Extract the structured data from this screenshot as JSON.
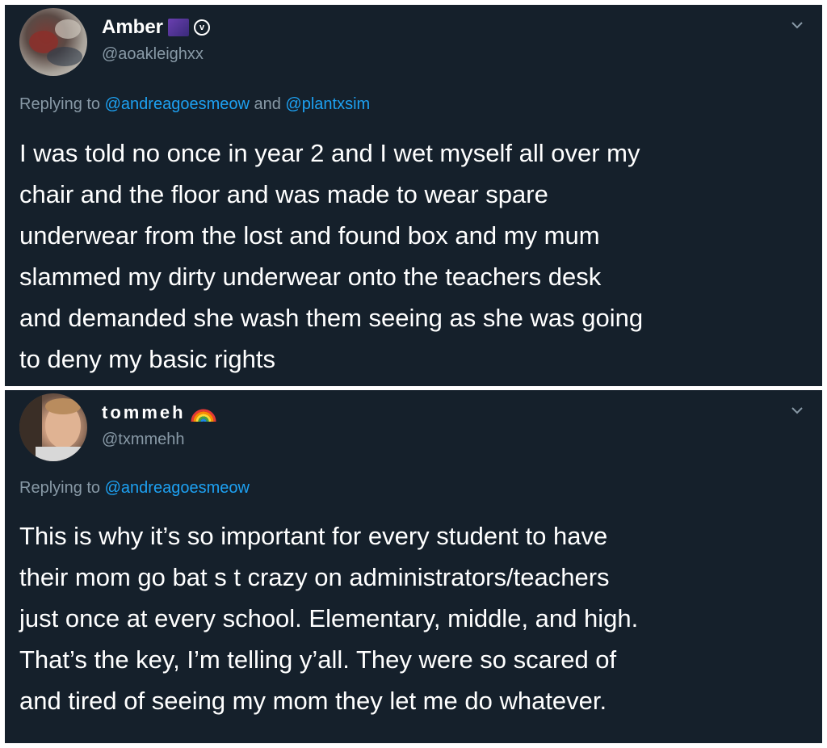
{
  "tweets": [
    {
      "display_name": "Amber",
      "handle": "@aoakleighxx",
      "replying_prefix": "Replying to",
      "replying_to_1": "@andreagoesmeow",
      "replying_joiner": "and",
      "replying_to_2": "@plantxsim",
      "text": "I was told no once in year 2 and I wet myself all over my\nchair and the floor and was made to wear spare\nunderwear from the lost and found box and my mum\nslammed my dirty underwear onto the teachers desk\nand demanded she wash them seeing as she was going\nto deny my basic rights",
      "emoji": "galaxy-emoji",
      "badge": "v"
    },
    {
      "display_name": "tommeh",
      "handle": "@txmmehh",
      "replying_prefix": "Replying to",
      "replying_to_1": "@andreagoesmeow",
      "text": "This is why it’s so important for every student to have\ntheir mom go bat s   t crazy on administrators/teachers\njust once at every school. Elementary, middle, and high.\nThat’s the key, I’m telling y’all. They were so scared of\nand tired of seeing my mom they let me do whatever.",
      "emoji": "rainbow-emoji"
    }
  ],
  "colors": {
    "background": "#15202b",
    "text": "#ffffff",
    "muted": "#8899a6",
    "link": "#1da1f2"
  }
}
